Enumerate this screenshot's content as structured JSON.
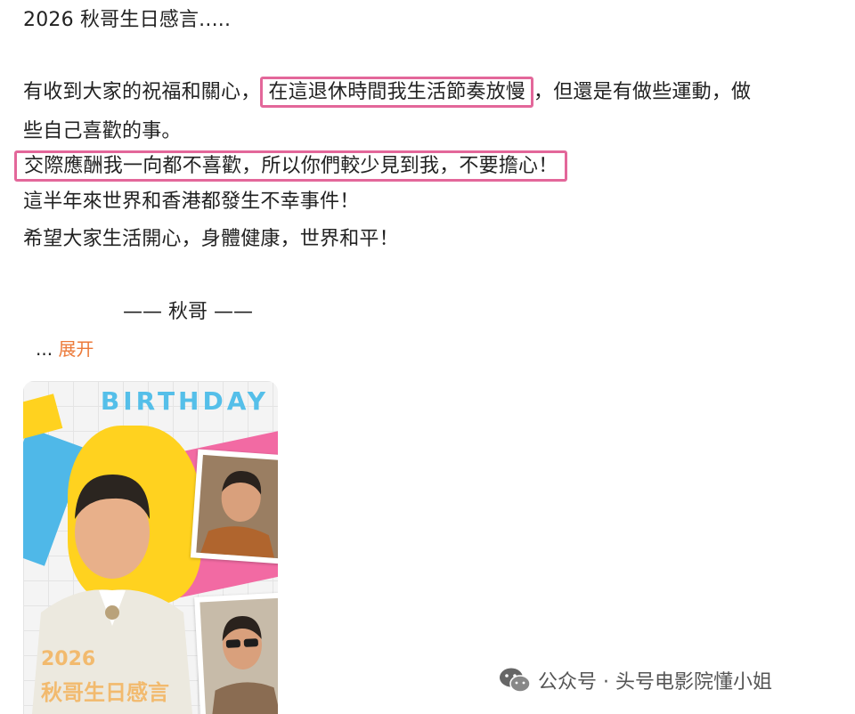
{
  "post": {
    "title": "2026 秋哥生日感言.....",
    "line2_a": "有收到大家的祝福和關心，",
    "line2_highlight": "在這退休時間我生活節奏放慢",
    "line2_b": "，但還是有做些運動，做",
    "line3": "些自己喜歡的事。",
    "line4_highlight": "交際應酬我一向都不喜歡，所以你們較少見到我，不要擔心！",
    "line5": "這半年來世界和香港都發生不幸事件！",
    "line6": "希望大家生活開心，身體健康，世界和平！",
    "signature": "——  秋哥 ——",
    "ellipsis": "...",
    "expand_label": "展开"
  },
  "poster": {
    "banner_text": "BIRTHDAY",
    "year_text": "2026",
    "caption_text": "秋哥生日感言"
  },
  "watermark": {
    "icon": "wechat-icon",
    "text": "公众号 · 头号电影院懂小姐"
  },
  "colors": {
    "highlight_border": "#e3679a",
    "expand_link": "#ec7a3a",
    "birthday_blue": "#55bfe9",
    "poster_pink": "#f26aa3",
    "poster_yellow": "#ffd21f"
  }
}
